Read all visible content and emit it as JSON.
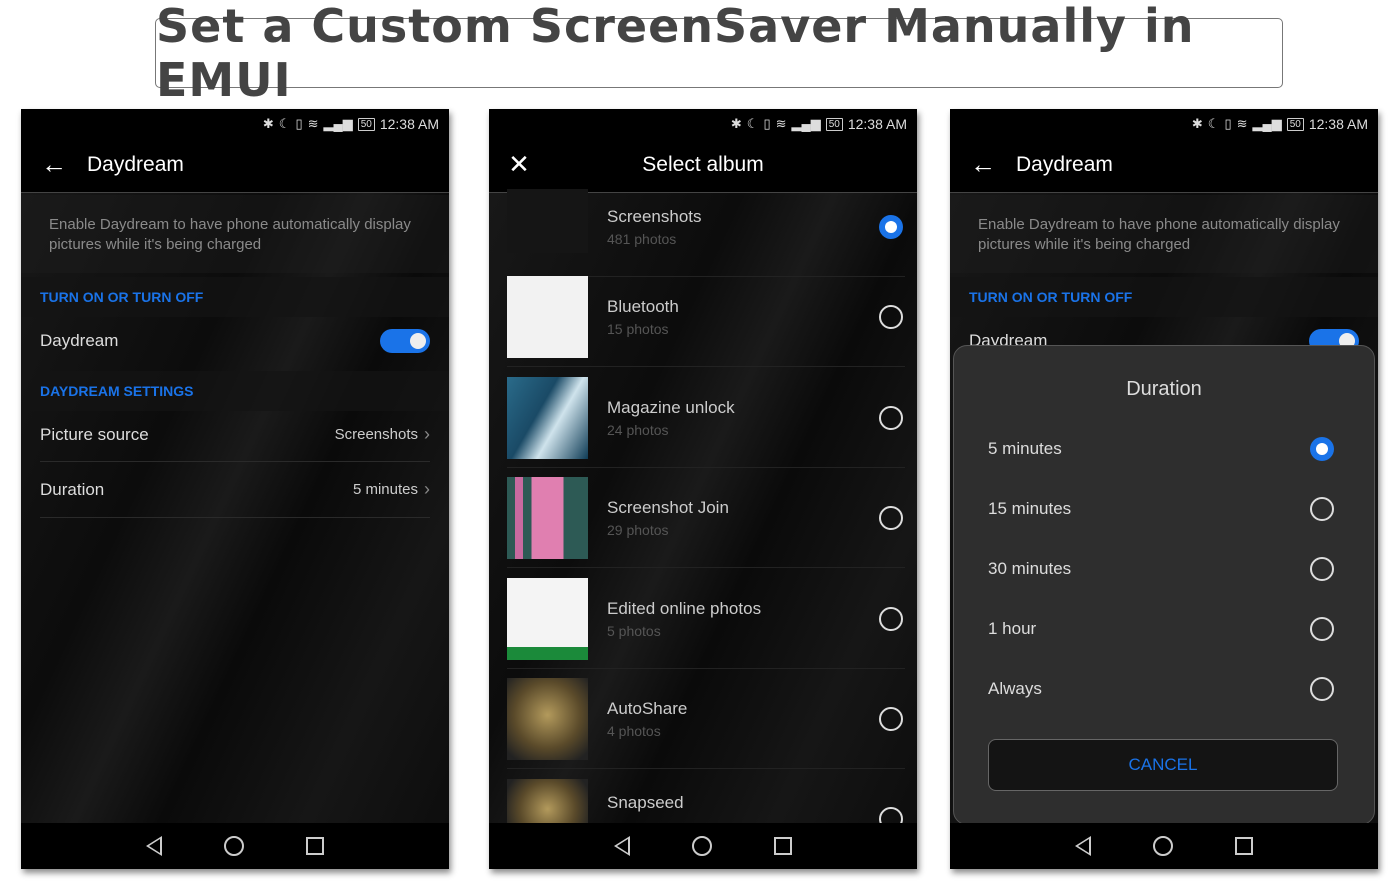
{
  "banner": {
    "title": "Set a Custom ScreenSaver Manually in EMUI"
  },
  "status": {
    "time": "12:38 AM",
    "battery": "50",
    "icons": [
      "bluetooth-icon",
      "do-not-disturb-moon-icon",
      "vibrate-icon",
      "wifi-icon",
      "signal-icon",
      "battery-icon"
    ]
  },
  "screen1": {
    "title": "Daydream",
    "description": "Enable Daydream to have phone automatically display pictures while it's being charged",
    "section1": "TURN ON OR TURN OFF",
    "toggle_label": "Daydream",
    "toggle_on": true,
    "section2": "DAYDREAM SETTINGS",
    "picture_source_label": "Picture source",
    "picture_source_value": "Screenshots",
    "duration_label": "Duration",
    "duration_value": "5 minutes"
  },
  "screen2": {
    "title": "Select album",
    "albums": [
      {
        "name": "Screenshots",
        "count": "481 photos",
        "selected": true
      },
      {
        "name": "Bluetooth",
        "count": "15 photos",
        "selected": false
      },
      {
        "name": "Magazine unlock",
        "count": "24 photos",
        "selected": false
      },
      {
        "name": "Screenshot Join",
        "count": "29 photos",
        "selected": false
      },
      {
        "name": "Edited online photos",
        "count": "5 photos",
        "selected": false
      },
      {
        "name": "AutoShare",
        "count": "4 photos",
        "selected": false
      },
      {
        "name": "Snapseed",
        "count": "",
        "selected": false
      }
    ]
  },
  "screen3": {
    "title": "Daydream",
    "description": "Enable Daydream to have phone automatically display pictures while it's being charged",
    "section1": "TURN ON OR TURN OFF",
    "toggle_label": "Daydream",
    "dialog": {
      "title": "Duration",
      "options": [
        {
          "label": "5 minutes",
          "selected": true
        },
        {
          "label": "15 minutes",
          "selected": false
        },
        {
          "label": "30 minutes",
          "selected": false
        },
        {
          "label": "1 hour",
          "selected": false
        },
        {
          "label": "Always",
          "selected": false
        }
      ],
      "cancel": "CANCEL"
    }
  },
  "colors": {
    "accent": "#1a73e8"
  }
}
